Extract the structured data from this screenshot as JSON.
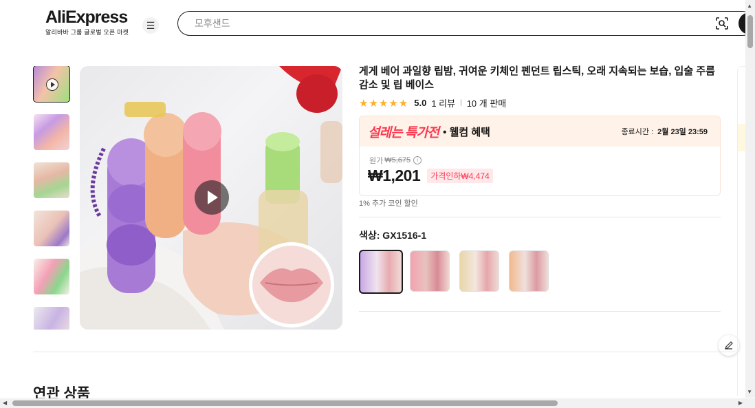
{
  "header": {
    "logo_text": "AliExpress",
    "logo_sub": "알리바바 그룹 글로벌 오픈 마켓",
    "search_placeholder": "모후샌드"
  },
  "product": {
    "title": "게게 베어 과일향 립밤, 귀여운 키체인 펜던트 립스틱, 오래 지속되는 보습, 입술 주름 감소 및 립 베이스",
    "stars": "★★★★★",
    "rating": "5.0",
    "reviews": "1 리뷰",
    "sold": "10 개 판매"
  },
  "promo": {
    "title": "설레는 특가전",
    "subtitle": "• 웰컴 혜택",
    "countdown_label": "종료시간 :",
    "countdown_value": "2월 23일 23:59"
  },
  "price": {
    "original_label": "원가",
    "original_value": "₩5,675",
    "current": "₩1,201",
    "discount": "가격인하₩4,474",
    "coin_text": "1% 추가 코인 할인"
  },
  "variant": {
    "label": "색상: GX1516-1"
  },
  "sections": {
    "related_title": "연관 상품"
  },
  "colors": {
    "accent": "#fd384f",
    "star": "#fdb022",
    "promo_bg": "#fff2e8"
  }
}
